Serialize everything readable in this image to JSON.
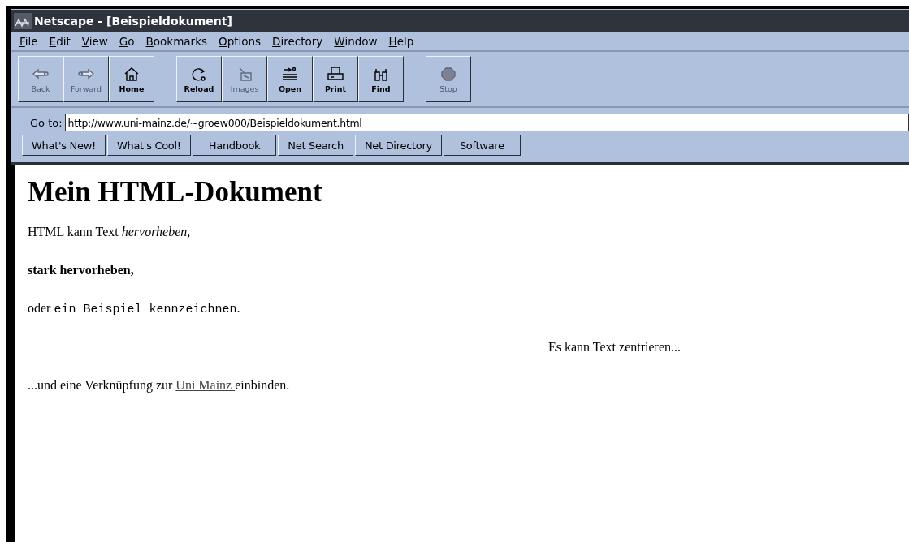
{
  "window": {
    "title": "Netscape - [Beispieldokument]"
  },
  "menu": [
    "File",
    "Edit",
    "View",
    "Go",
    "Bookmarks",
    "Options",
    "Directory",
    "Window",
    "Help"
  ],
  "toolbar": {
    "groups": [
      [
        {
          "label": "Back",
          "disabled": true
        },
        {
          "label": "Forward",
          "disabled": true
        },
        {
          "label": "Home",
          "disabled": false
        }
      ],
      [
        {
          "label": "Reload",
          "disabled": false
        },
        {
          "label": "Images",
          "disabled": true
        },
        {
          "label": "Open",
          "disabled": false
        },
        {
          "label": "Print",
          "disabled": false
        },
        {
          "label": "Find",
          "disabled": false
        }
      ],
      [
        {
          "label": "Stop",
          "disabled": true
        }
      ]
    ]
  },
  "location": {
    "label": "Go to:",
    "value": "http://www.uni-mainz.de/~groew000/Beispieldokument.html"
  },
  "directory_buttons": [
    "What's New!",
    "What's Cool!",
    "Handbook",
    "Net Search",
    "Net Directory",
    "Software"
  ],
  "content": [
    {
      "kind": "heading",
      "segments": [
        {
          "kind": "plain",
          "text": "Mein HTML-Dokument"
        }
      ]
    },
    {
      "kind": "paragraph",
      "segments": [
        {
          "kind": "plain",
          "text": "HTML kann Text "
        },
        {
          "kind": "italic",
          "text": "hervorheben,"
        }
      ]
    },
    {
      "kind": "paragraph",
      "segments": [
        {
          "kind": "bold",
          "text": "stark hervorheben,"
        }
      ]
    },
    {
      "kind": "paragraph",
      "segments": [
        {
          "kind": "plain",
          "text": "oder "
        },
        {
          "kind": "code",
          "text": "ein Beispiel kennzeichnen"
        },
        {
          "kind": "plain",
          "text": "."
        }
      ]
    },
    {
      "kind": "centered",
      "segments": [
        {
          "kind": "plain",
          "text": "Es kann Text zentrieren..."
        }
      ]
    },
    {
      "kind": "paragraph",
      "segments": [
        {
          "kind": "plain",
          "text": "...und eine Verknüpfung zur "
        },
        {
          "kind": "link",
          "text": "Uni Mainz "
        },
        {
          "kind": "plain",
          "text": "einbinden."
        }
      ]
    }
  ]
}
